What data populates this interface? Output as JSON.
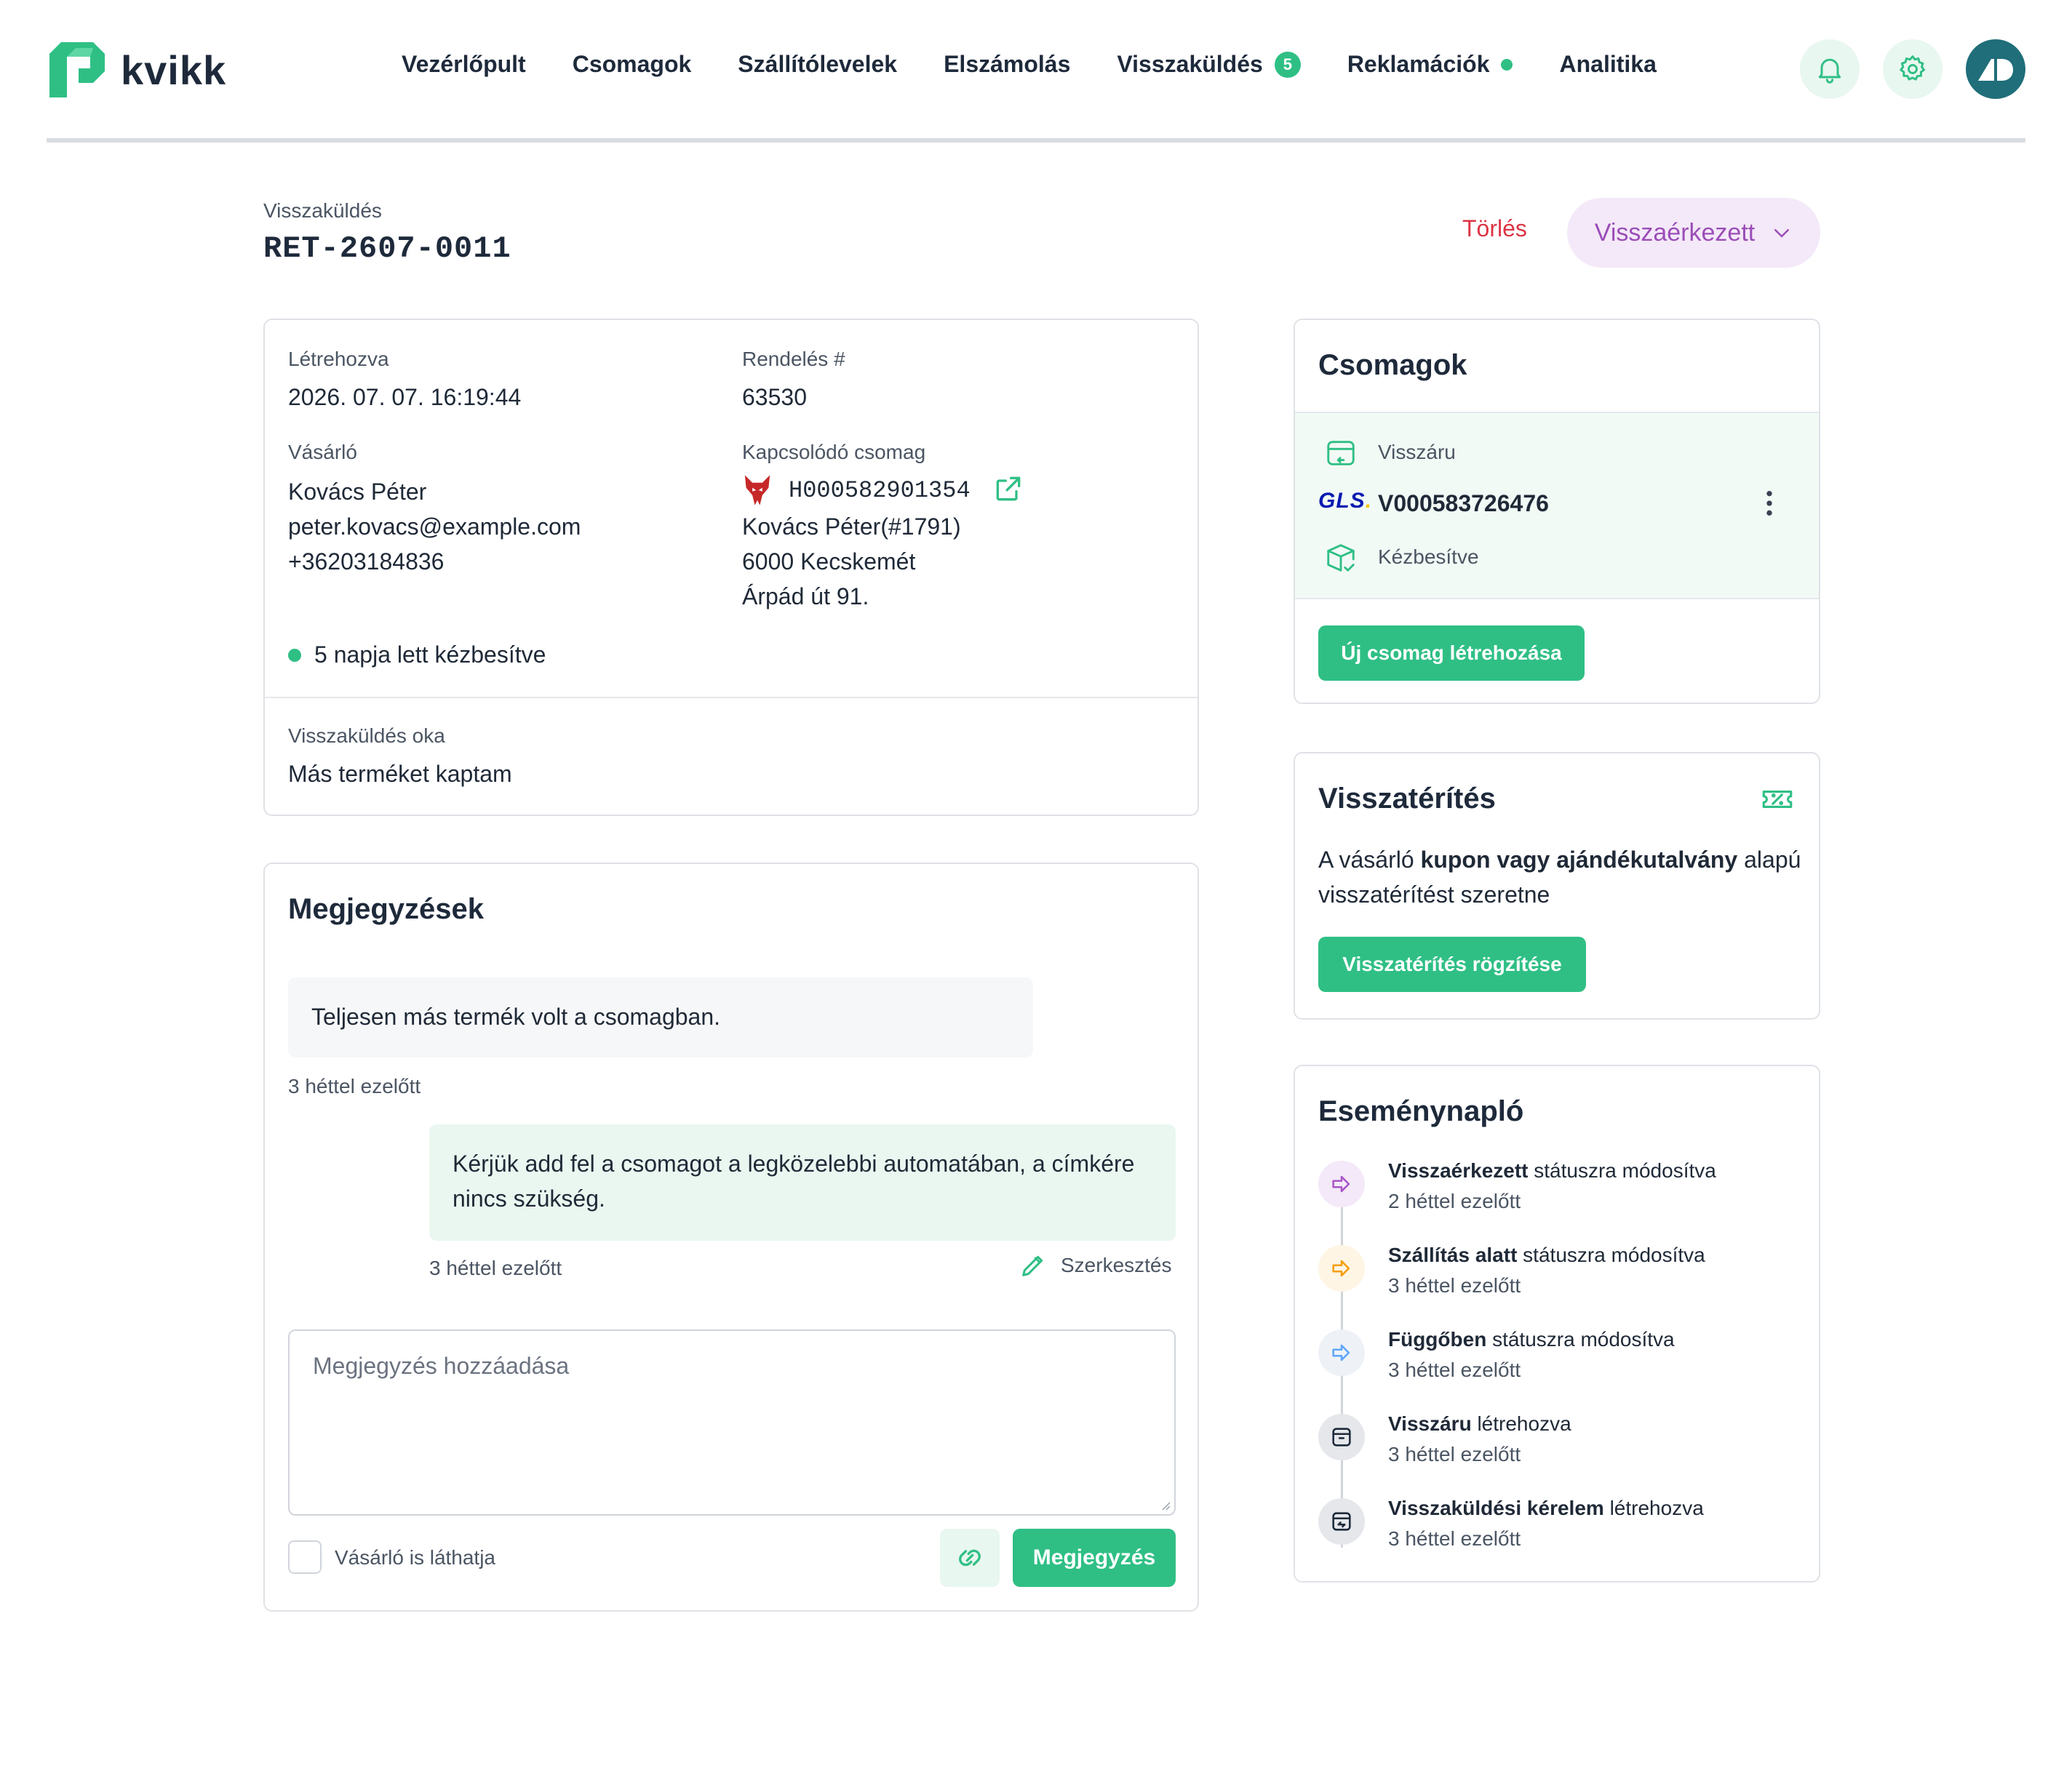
{
  "brand": {
    "name": "kvikk",
    "accent": "#2fbf85"
  },
  "nav": {
    "items": [
      {
        "label": "Vezérlőpult"
      },
      {
        "label": "Csomagok"
      },
      {
        "label": "Szállítólevelek"
      },
      {
        "label": "Elszámolás"
      },
      {
        "label": "Visszaküldés",
        "badge": "5"
      },
      {
        "label": "Reklamációk",
        "dot": true
      },
      {
        "label": "Analitika"
      }
    ]
  },
  "header_icons": [
    "bell-icon",
    "gear-icon",
    "avatar"
  ],
  "page": {
    "section_label": "Visszaküldés",
    "return_id": "RET-2607-0011",
    "delete_label": "Törlés",
    "status_label": "Visszaérkezett"
  },
  "details": {
    "created_label": "Létrehozva",
    "created_value": "2026. 07. 07. 16:19:44",
    "order_label": "Rendelés #",
    "order_value": "63530",
    "customer_label": "Vásárló",
    "customer_name": "Kovács Péter",
    "customer_email": "peter.kovacs@example.com",
    "customer_phone": "+36203184836",
    "related_label": "Kapcsolódó csomag",
    "related_tracking": "H000582901354",
    "related_name": "Kovács Péter(#1791)",
    "related_city": "6000 Kecskemét",
    "related_street": "Árpád út 91.",
    "delivered_text": "5 napja lett kézbesítve",
    "reason_label": "Visszaküldés oka",
    "reason_value": "Más terméket kaptam"
  },
  "notes": {
    "title": "Megjegyzések",
    "items": [
      {
        "text": "Teljesen más termék volt a csomagban.",
        "time": "3 héttel ezelőtt"
      },
      {
        "text": "Kérjük add fel a csomagot a legközelebbi automatában, a címkére nincs szükség.",
        "time": "3 héttel ezelőtt",
        "edit_label": "Szerkesztés"
      }
    ],
    "input_placeholder": "Megjegyzés hozzáadása",
    "visible_label": "Vásárló is láthatja",
    "submit_label": "Megjegyzés"
  },
  "packages": {
    "title": "Csomagok",
    "type_label": "Visszáru",
    "carrier": "GLS",
    "tracking": "V000583726476",
    "status": "Kézbesítve",
    "new_label": "Új csomag létrehozása"
  },
  "refund": {
    "title": "Visszatérítés",
    "text_pre": "A vásárló ",
    "text_bold": "kupon vagy ajándékutalvány",
    "text_mid": " alapú",
    "text_line2": "visszatérítést szeretne",
    "button_label": "Visszatérítés rögzítése"
  },
  "events": {
    "title": "Eseménynapló",
    "items": [
      {
        "bold": "Visszaérkezett",
        "rest": " státuszra módosítva",
        "time": "2 héttel ezelőtt",
        "color": "#a855c8",
        "bg": "#f4e9f8"
      },
      {
        "bold": "Szállítás alatt",
        "rest": " státuszra módosítva",
        "time": "3 héttel ezelőtt",
        "color": "#f59e0b",
        "bg": "#fef5e4"
      },
      {
        "bold": "Függőben",
        "rest": " státuszra módosítva",
        "time": "3 héttel ezelőtt",
        "color": "#60a5fa",
        "bg": "#eef2f7"
      },
      {
        "bold": "Visszáru",
        "rest": " létrehozva",
        "time": "3 héttel ezelőtt",
        "color": "#1e2a3b",
        "bg": "#e5e7eb"
      },
      {
        "bold": "Visszaküldési kérelem",
        "rest": " létrehozva",
        "time": "3 héttel ezelőtt",
        "color": "#1e2a3b",
        "bg": "#e5e7eb"
      }
    ]
  }
}
